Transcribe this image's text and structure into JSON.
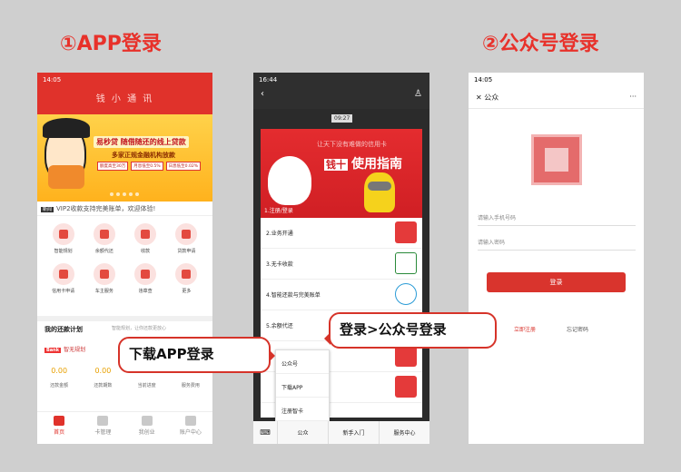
{
  "headings": {
    "app": "①APP登录",
    "mp": "②公众号登录"
  },
  "phone1": {
    "status_time": "14:05",
    "title": "钱 小 通 讯",
    "banner": {
      "tag": "易秒贷 随借随还的线上贷款",
      "sub": "多家正规金融机构放款",
      "chips": [
        "额度高至30万",
        "月息低至0.5%",
        "日息低至0.02%"
      ]
    },
    "notice_badge": "新闻",
    "notice": "VIP2收款支持完美账单，欢迎体验!",
    "grid": [
      "智能规划",
      "余额代还",
      "收款",
      "贷款申请",
      "信用卡申请",
      "车主服务",
      "违章查",
      "更多"
    ],
    "plan_title": "我的还款计划",
    "plan_sub": "智能规划，让你还款更放心",
    "plan_bank_badge": "Bank",
    "plan_bank": "智无规划",
    "values": [
      {
        "value": "0.00",
        "label": "还款金额"
      },
      {
        "value": "0.00",
        "label": "还款期数"
      },
      {
        "value": "",
        "label": "当前进度"
      },
      {
        "value": "",
        "label": "服务费用"
      }
    ],
    "tabs": [
      "首页",
      "卡管理",
      "我创业",
      "账户中心"
    ]
  },
  "phone2": {
    "status_time": "16:44",
    "time_badge": "09:27",
    "poster_title": "让天下没有难做的信用卡",
    "poster_big": "使用指南",
    "poster_badge": "钱十",
    "poster_caption": "1.注册/登录",
    "rows": [
      "2.业务开通",
      "3.无卡收款",
      "4.智能还款与完美账单",
      "5.余额代还"
    ],
    "popup": [
      "公众号",
      "下载APP",
      "注册智卡"
    ],
    "menu": [
      "公众",
      "新手入门",
      "服务中心"
    ],
    "keyboard_icon": "⌨"
  },
  "phone3": {
    "status_time": "14:05",
    "close": "✕",
    "title": "公众",
    "more": "···",
    "phone_placeholder": "请输入手机号码",
    "password_placeholder": "请输入密码",
    "login_button": "登录",
    "register": "立即注册",
    "forgot": "忘记密码"
  },
  "callouts": {
    "app": "下载APP登录",
    "mp": "登录>公众号登录"
  }
}
